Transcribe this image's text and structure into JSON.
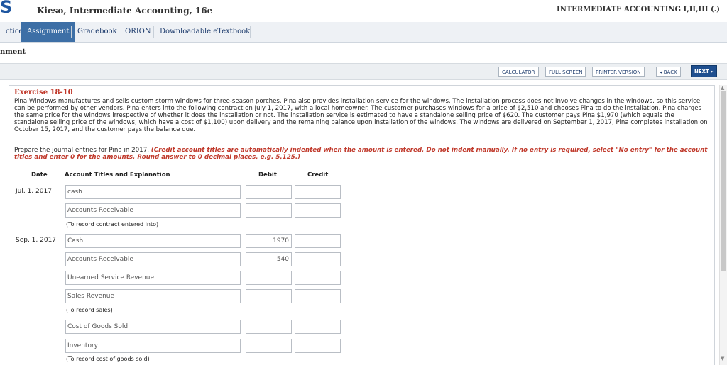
{
  "header": {
    "logo": "S",
    "book_title": "Kieso, Intermediate Accounting, 16e",
    "course": "INTERMEDIATE ACCOUNTING I,II,III (.)"
  },
  "nav": {
    "tabs": [
      "ctice",
      "Assignment",
      "Gradebook",
      "ORION",
      "Downloadable eTextbook"
    ],
    "active": "Assignment"
  },
  "section_title": "nment",
  "toolbar": {
    "calculator": "CALCULATOR",
    "full_screen": "FULL SCREEN",
    "printer_version": "PRINTER VERSION",
    "back": "◂ BACK",
    "next": "NEXT ▸"
  },
  "exercise": {
    "title": "Exercise 18-10",
    "problem": "Pina Windows manufactures and sells custom storm windows for three-season porches. Pina also provides installation service for the windows. The installation process does not involve changes in the windows, so this service can be performed by other vendors. Pina enters into the following contract on July 1, 2017, with a local homeowner. The customer purchases windows for a price of $2,510 and chooses Pina to do the installation. Pina charges the same price for the windows irrespective of whether it does the installation or not. The installation service is estimated to have a standalone selling price of $620. The customer pays Pina $1,970 (which equals the standalone selling price of the windows, which have a cost of $1,100) upon delivery and the remaining balance upon installation of the windows. The windows are delivered on September 1, 2017, Pina completes installation on October 15, 2017, and the customer pays the balance due.",
    "instruction_plain": "Prepare the journal entries for Pina in 2017. ",
    "instruction_red": "(Credit account titles are automatically indented when the amount is entered. Do not indent manually. If no entry is required, select \"No entry\" for the account titles and enter 0 for the amounts. Round answer to 0 decimal places, e.g. 5,125.)"
  },
  "table": {
    "col_date": "Date",
    "col_account": "Account Titles and Explanation",
    "col_debit": "Debit",
    "col_credit": "Credit"
  },
  "entries": {
    "e1": {
      "date": "Jul. 1, 2017",
      "rows": [
        {
          "account": "cash",
          "debit": "",
          "credit": ""
        },
        {
          "account": "Accounts Receivable",
          "debit": "",
          "credit": ""
        }
      ],
      "note": "(To record contract entered into)"
    },
    "e2": {
      "date": "Sep. 1, 2017",
      "rows": [
        {
          "account": "Cash",
          "debit": "1970",
          "credit": ""
        },
        {
          "account": "Accounts Receivable",
          "debit": "540",
          "credit": ""
        },
        {
          "account": "Unearned Service Revenue",
          "debit": "",
          "credit": ""
        },
        {
          "account": "Sales Revenue",
          "debit": "",
          "credit": ""
        }
      ],
      "note": "(To record sales)"
    },
    "e3": {
      "rows": [
        {
          "account": "Cost of Goods Sold",
          "debit": "",
          "credit": ""
        },
        {
          "account": "Inventory",
          "debit": "",
          "credit": ""
        }
      ],
      "note": "(To record cost of goods sold)"
    }
  }
}
